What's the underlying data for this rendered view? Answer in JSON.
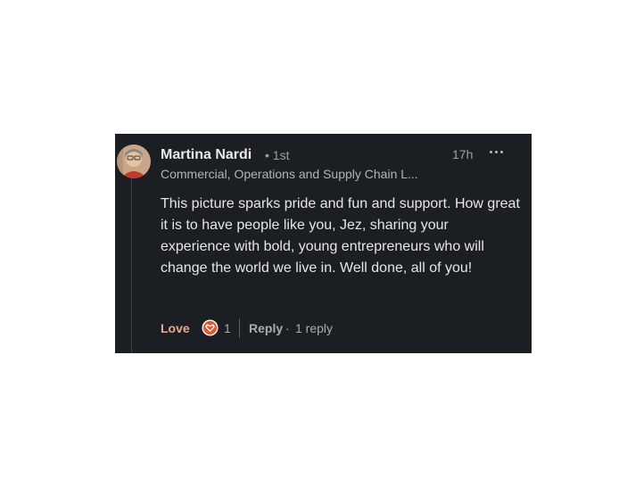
{
  "comment": {
    "author": {
      "name": "Martina Nardi",
      "degree": "• 1st",
      "headline": "Commercial, Operations and Supply Chain L..."
    },
    "timestamp": "17h",
    "menu_icon": "more-horizontal-icon",
    "text": "This picture sparks pride and fun and support. How great it is to have people like you, Jez, sharing your experience with bold, young entrepreneurs who will change the world we live in. Well done, all of you!",
    "actions": {
      "reaction_label": "Love",
      "separator": "·",
      "reaction_icon": "heart-icon",
      "reaction_count": "1",
      "reply_label": "Reply",
      "reply_count": "1 reply"
    }
  },
  "colors": {
    "card_background": "#1b1f23",
    "love_accent": "#e9a892",
    "heart_badge": "#d65c37"
  }
}
